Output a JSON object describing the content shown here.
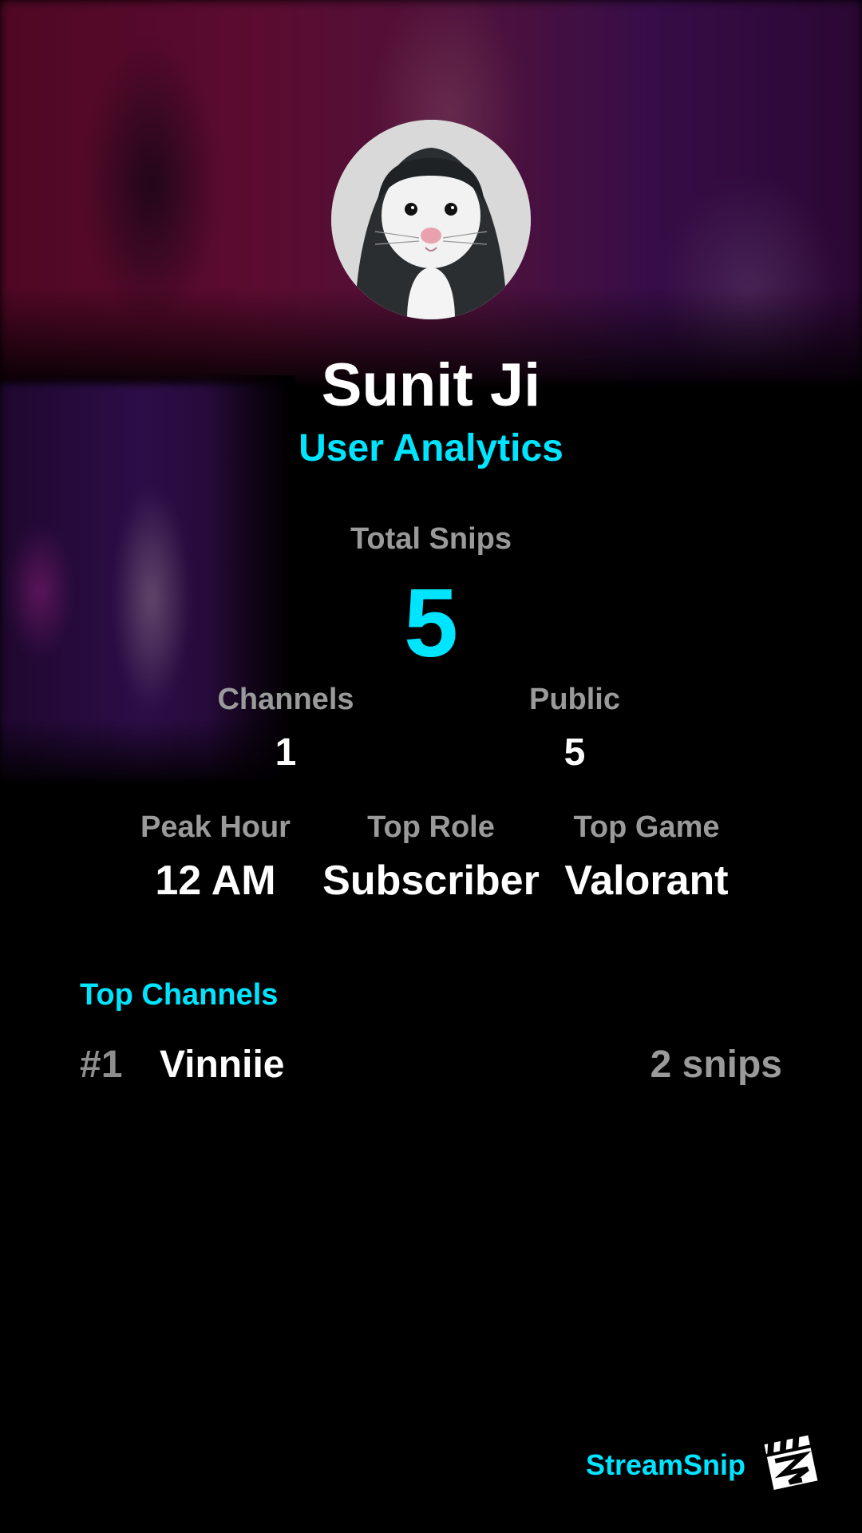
{
  "profile": {
    "display_name": "Sunit Ji",
    "subtitle": "User Analytics",
    "avatar": "white-rat-in-hoodie-avatar"
  },
  "stats": {
    "total_snips_label": "Total Snips",
    "total_snips_value": "5",
    "channels_label": "Channels",
    "channels_value": "1",
    "public_label": "Public",
    "public_value": "5",
    "peak_hour_label": "Peak Hour",
    "peak_hour_value": "12 AM",
    "top_role_label": "Top Role",
    "top_role_value": "Subscriber",
    "top_game_label": "Top Game",
    "top_game_value": "Valorant"
  },
  "top_channels": {
    "title": "Top Channels",
    "items": [
      {
        "rank": "#1",
        "name": "Vinniie",
        "count": "2 snips"
      }
    ]
  },
  "brand": {
    "name": "StreamSnip",
    "logo_icon": "clapperboard-logo-icon"
  },
  "colors": {
    "accent": "#00e5ff",
    "background": "#000000",
    "muted_text": "#9a9a9a",
    "primary_text": "#ffffff"
  }
}
